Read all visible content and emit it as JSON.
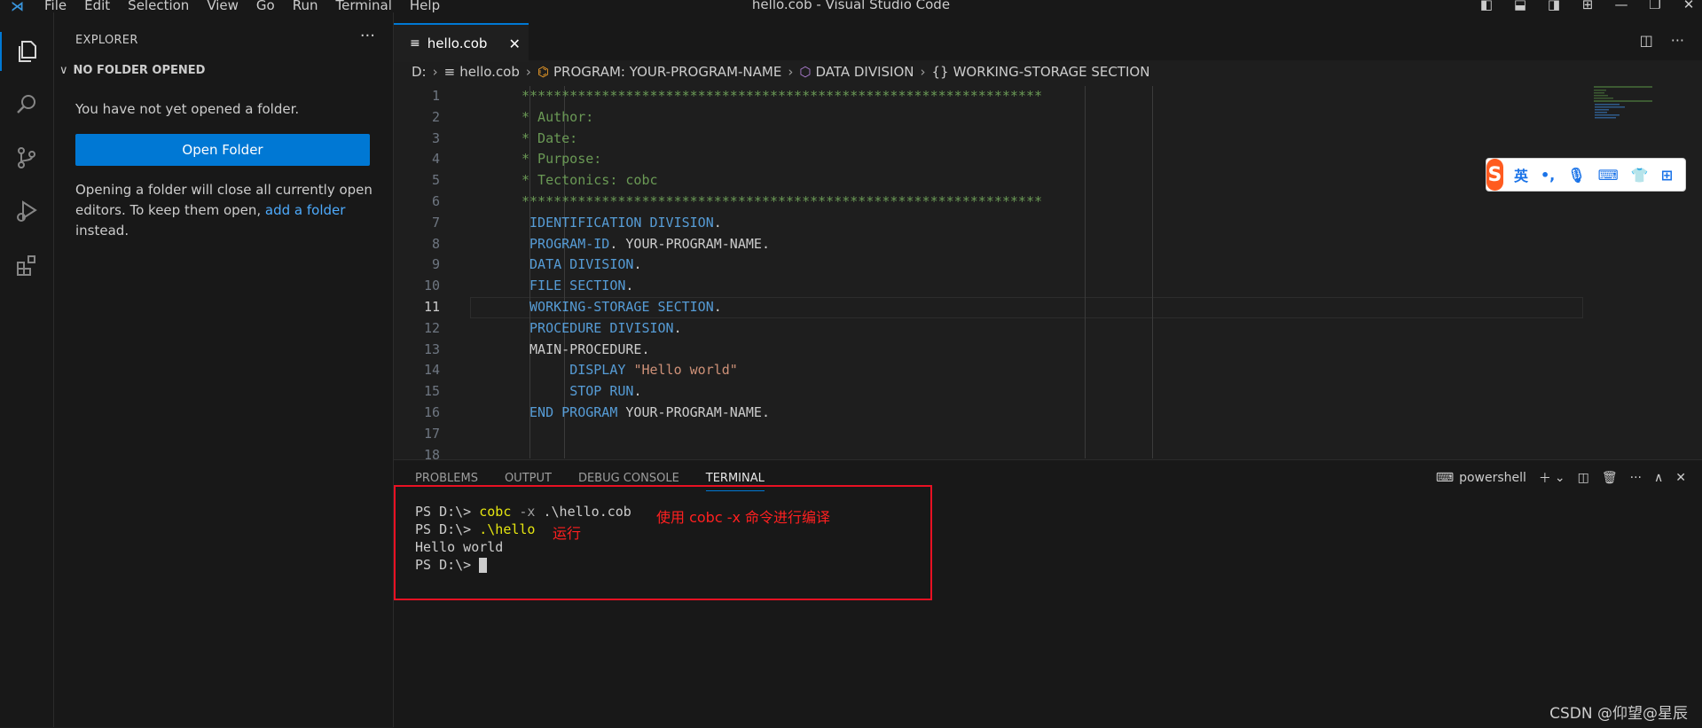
{
  "titlebar": {
    "menu": [
      "File",
      "Edit",
      "Selection",
      "View",
      "Go",
      "Run",
      "Terminal",
      "Help"
    ],
    "title": "hello.cob - Visual Studio Code"
  },
  "sidebar": {
    "header": "EXPLORER",
    "section": "NO FOLDER OPENED",
    "message": "You have not yet opened a folder.",
    "open_folder_label": "Open Folder",
    "info_before": "Opening a folder will close all currently open editors. To keep them open, ",
    "info_link": "add a folder",
    "info_after": " instead."
  },
  "tab": {
    "label": "hello.cob"
  },
  "breadcrumb": {
    "drive": "D:",
    "file": "hello.cob",
    "program": "PROGRAM: YOUR-PROGRAM-NAME",
    "division": "DATA DIVISION",
    "section": "WORKING-STORAGE SECTION"
  },
  "editor": {
    "current_line": 11,
    "line_numbers": [
      "1",
      "2",
      "3",
      "4",
      "5",
      "6",
      "7",
      "8",
      "9",
      "10",
      "11",
      "12",
      "13",
      "14",
      "15",
      "16",
      "17",
      "18"
    ],
    "stars": "*****************************************************************",
    "l2": "* Author:",
    "l3": "* Date:",
    "l4": "* Purpose:",
    "l5": "* Tectonics: cobc",
    "identification": "IDENTIFICATION DIVISION",
    "program_id_kw": "PROGRAM-ID",
    "program_name": "YOUR-PROGRAM-NAME",
    "data_division": "DATA DIVISION",
    "file_section": "FILE SECTION",
    "ws_section": "WORKING-STORAGE SECTION",
    "procedure_division": "PROCEDURE DIVISION",
    "main_procedure": "MAIN-PROCEDURE.",
    "display_kw": "DISPLAY",
    "hello_str": "\"Hello world\"",
    "stop_run": "STOP RUN",
    "end_program": "END PROGRAM",
    "dot": "."
  },
  "ime": {
    "lang": "英",
    "punct": "•,"
  },
  "panel": {
    "tabs": [
      "PROBLEMS",
      "OUTPUT",
      "DEBUG CONSOLE",
      "TERMINAL"
    ],
    "shell": "powershell"
  },
  "terminal": {
    "prompt": "PS D:\\> ",
    "cmd1": "cobc",
    "flag1": " -x ",
    "arg1": ".\\hello.cob",
    "cmd2": ".\\hello",
    "output": "Hello world"
  },
  "annotations": {
    "compile": "使用 cobc -x  命令进行编译",
    "run": "运行"
  },
  "watermark": "CSDN @仰望@星辰",
  "colors": {
    "accent": "#0078d4",
    "annotation_red": "#e81123"
  }
}
